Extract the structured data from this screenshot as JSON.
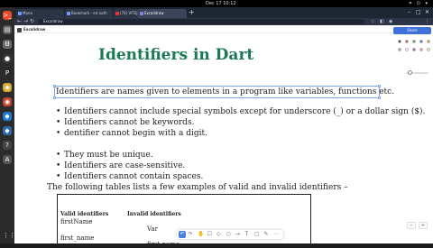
{
  "system": {
    "clock": "Dec 17  10:12",
    "tray": "⌗ ⏻ ▾"
  },
  "dock": {
    "apps": [
      {
        "name": "terminal-icon",
        "glyph": ">_",
        "color": "#e84a2c"
      },
      {
        "name": "files-icon",
        "glyph": "▤",
        "color": "#5a5a5a"
      },
      {
        "name": "settings-icon",
        "glyph": "⚙",
        "color": "#6b6b6b"
      },
      {
        "name": "obs-icon",
        "glyph": "●",
        "color": "#3a3a3a"
      },
      {
        "name": "app-icon-p",
        "glyph": "P",
        "color": "#2a2a2a"
      },
      {
        "name": "chrome-icon",
        "glyph": "◉",
        "color": "#d9a62b"
      },
      {
        "name": "chrome-dev-icon",
        "glyph": "◉",
        "color": "#c4452f"
      },
      {
        "name": "vscode-icon",
        "glyph": "◆",
        "color": "#1f7ad4"
      },
      {
        "name": "vscode-alt-icon",
        "glyph": "◆",
        "color": "#2d6aa8"
      },
      {
        "name": "app-icon-q",
        "glyph": "?",
        "color": "#444"
      },
      {
        "name": "app-icon-a",
        "glyph": "A",
        "color": "#555"
      }
    ],
    "grid_icon": "⋮⋮"
  },
  "browser": {
    "tabs": [
      {
        "label": "Mana"
      },
      {
        "label": "Bookmark - ed auth"
      },
      {
        "label": "(76) VITEJ Rajpura"
      },
      {
        "label": "Excalidraw"
      }
    ],
    "active_tab": 3,
    "url": "Excalidraw"
  },
  "app": {
    "name": "Excalidraw",
    "primary_button": "Share"
  },
  "document": {
    "title": "Identifiers in Dart",
    "intro": "Identifiers are names given to elements in a program like variables, functions etc.",
    "rules_a": [
      "Identifiers cannot include special symbols except for underscore (_) or a dollar sign ($).",
      "Identifiers cannot be keywords.",
      "dentifier cannot begin with a digit."
    ],
    "rules_b": [
      "They must be unique.",
      "Identifiers are case-sensitive.",
      "Identifiers cannot contain spaces."
    ],
    "table_intro": "The following tables lists a few examples of valid and invalid identifiers –",
    "table": {
      "headers": [
        "Valid identifiers",
        "Invalid identifiers"
      ],
      "valid": [
        "firstName",
        "first_name"
      ],
      "invalid": [
        "Var",
        "first name"
      ]
    }
  },
  "floating_toolbar": {
    "tools": [
      "↶",
      "↷",
      "✋",
      "☐",
      "◇",
      "○",
      "→",
      "T",
      "▢",
      "✎",
      "⋯"
    ]
  },
  "palette": {
    "colors": [
      "#1e1e1e",
      "#e03131",
      "#2f9e44",
      "#1971c2",
      "#f08c00",
      "#a0a0a0",
      "#ffffff",
      "#9c36b5",
      "#f783ac",
      "#ffec99"
    ]
  },
  "zoom": {
    "out": "−",
    "in": "+"
  }
}
